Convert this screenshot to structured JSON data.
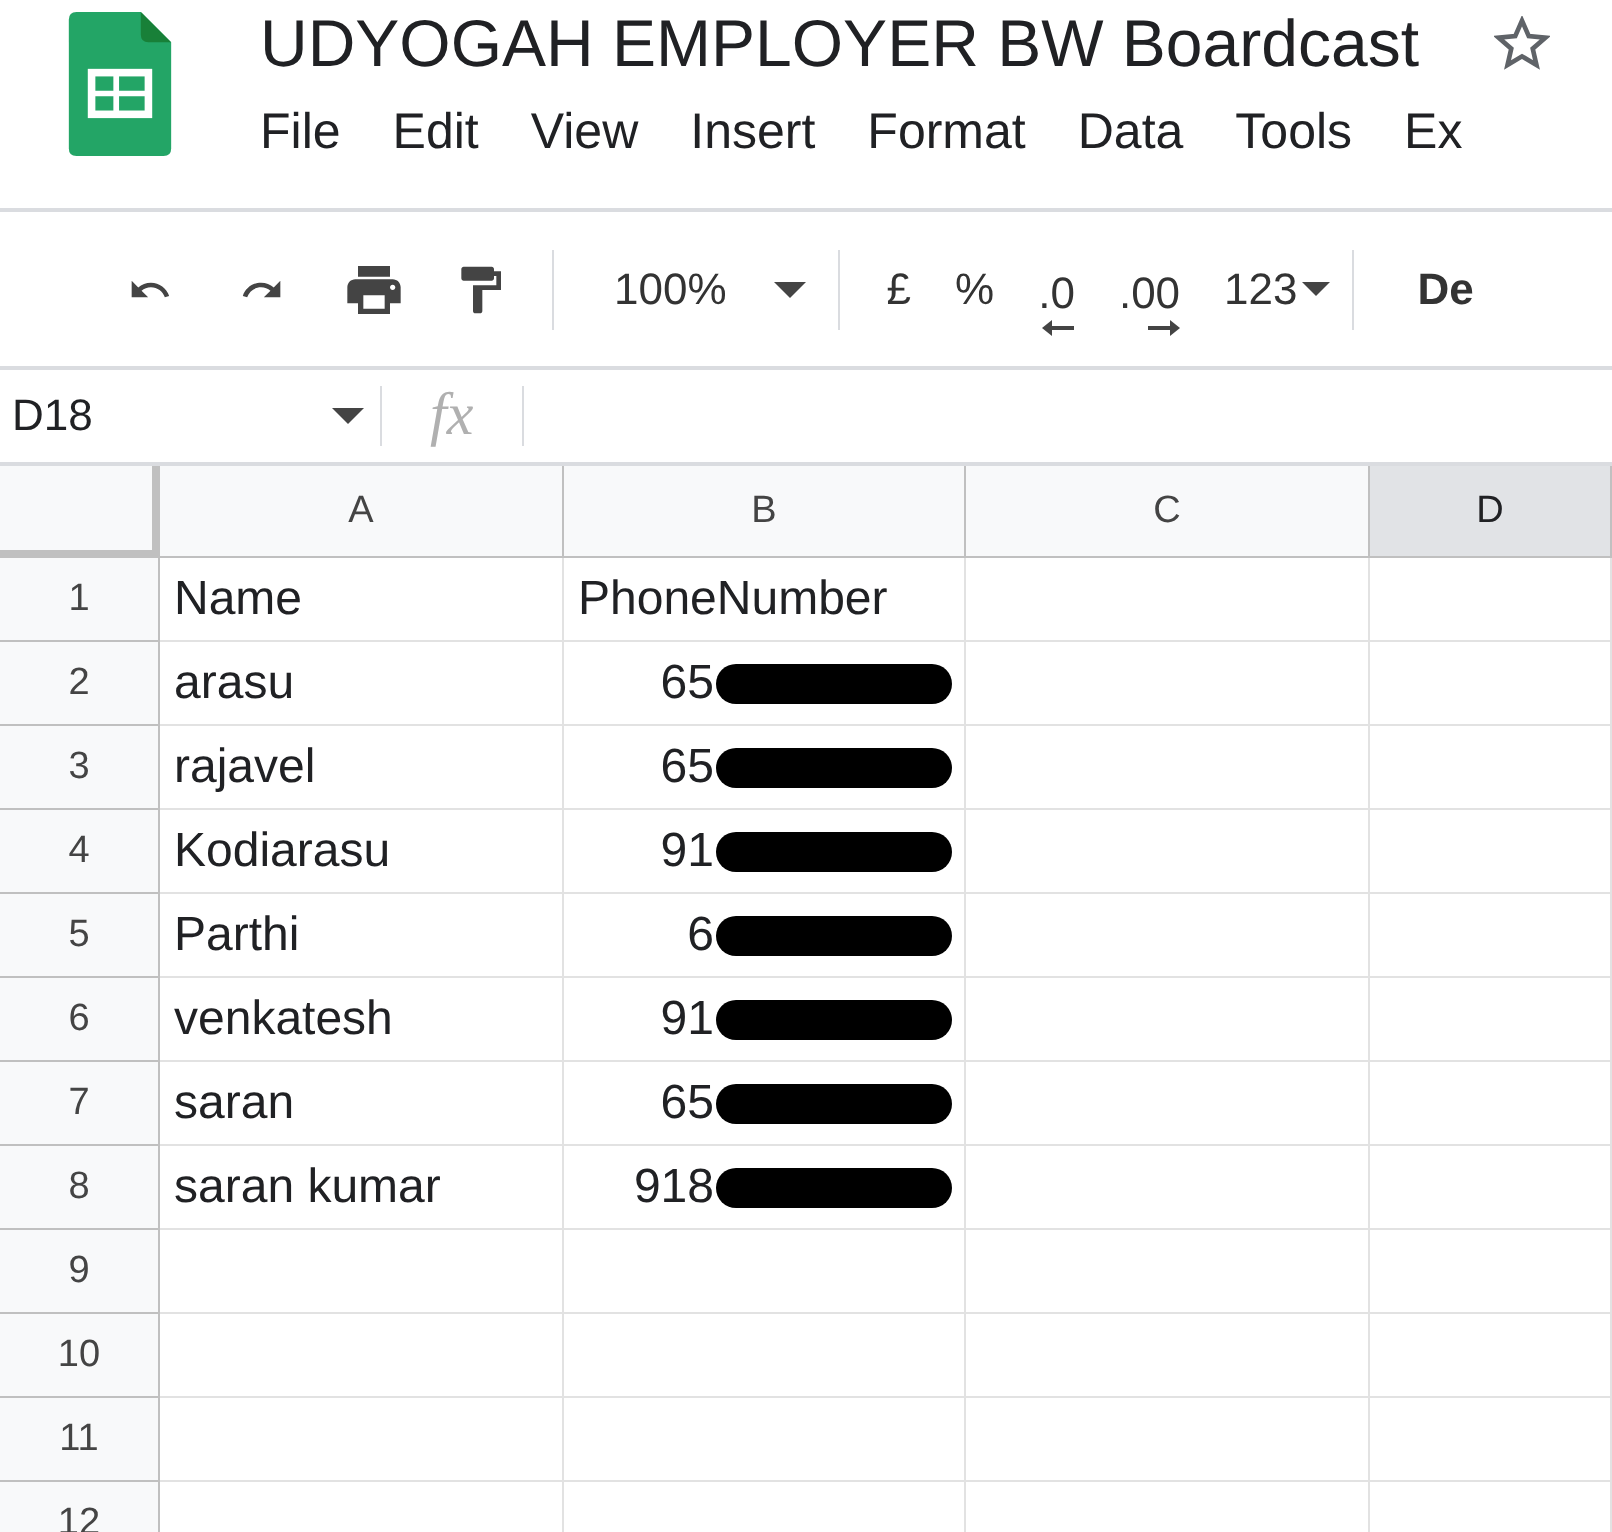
{
  "app": {
    "title": "UDYOGAH EMPLOYER BW Boardcast",
    "menu": [
      "File",
      "Edit",
      "View",
      "Insert",
      "Format",
      "Data",
      "Tools",
      "Ex"
    ]
  },
  "toolbar": {
    "zoom": "100%",
    "buttons": [
      {
        "kind": "text",
        "label": "£"
      },
      {
        "kind": "text",
        "label": "%"
      },
      {
        "kind": "decrease",
        "label": ".0"
      },
      {
        "kind": "increase",
        "label": ".00"
      },
      {
        "kind": "dropdown",
        "label": "123"
      }
    ],
    "font": "De"
  },
  "formula_bar": {
    "cell_ref": "D18",
    "fx": "fx"
  },
  "sheet": {
    "columns": [
      {
        "label": "A",
        "selected": false
      },
      {
        "label": "B",
        "selected": false
      },
      {
        "label": "C",
        "selected": false
      },
      {
        "label": "D",
        "selected": true
      }
    ],
    "rows": [
      {
        "number": "1",
        "name": "Name",
        "phone": {
          "text": "PhoneNumber",
          "redacted": false
        }
      },
      {
        "number": "2",
        "name": "arasu",
        "phone": {
          "text": "65",
          "redacted": true
        }
      },
      {
        "number": "3",
        "name": "rajavel",
        "phone": {
          "text": "65",
          "redacted": true
        }
      },
      {
        "number": "4",
        "name": "Kodiarasu",
        "phone": {
          "text": "91",
          "redacted": true
        }
      },
      {
        "number": "5",
        "name": "Parthi",
        "phone": {
          "text": "6",
          "redacted": true
        }
      },
      {
        "number": "6",
        "name": "venkatesh",
        "phone": {
          "text": "91",
          "redacted": true
        }
      },
      {
        "number": "7",
        "name": "saran",
        "phone": {
          "text": "65",
          "redacted": true
        }
      },
      {
        "number": "8",
        "name": "saran kumar",
        "phone": {
          "text": "918",
          "redacted": true
        }
      },
      {
        "number": "9"
      },
      {
        "number": "10"
      },
      {
        "number": "11"
      },
      {
        "number": "12"
      }
    ]
  }
}
